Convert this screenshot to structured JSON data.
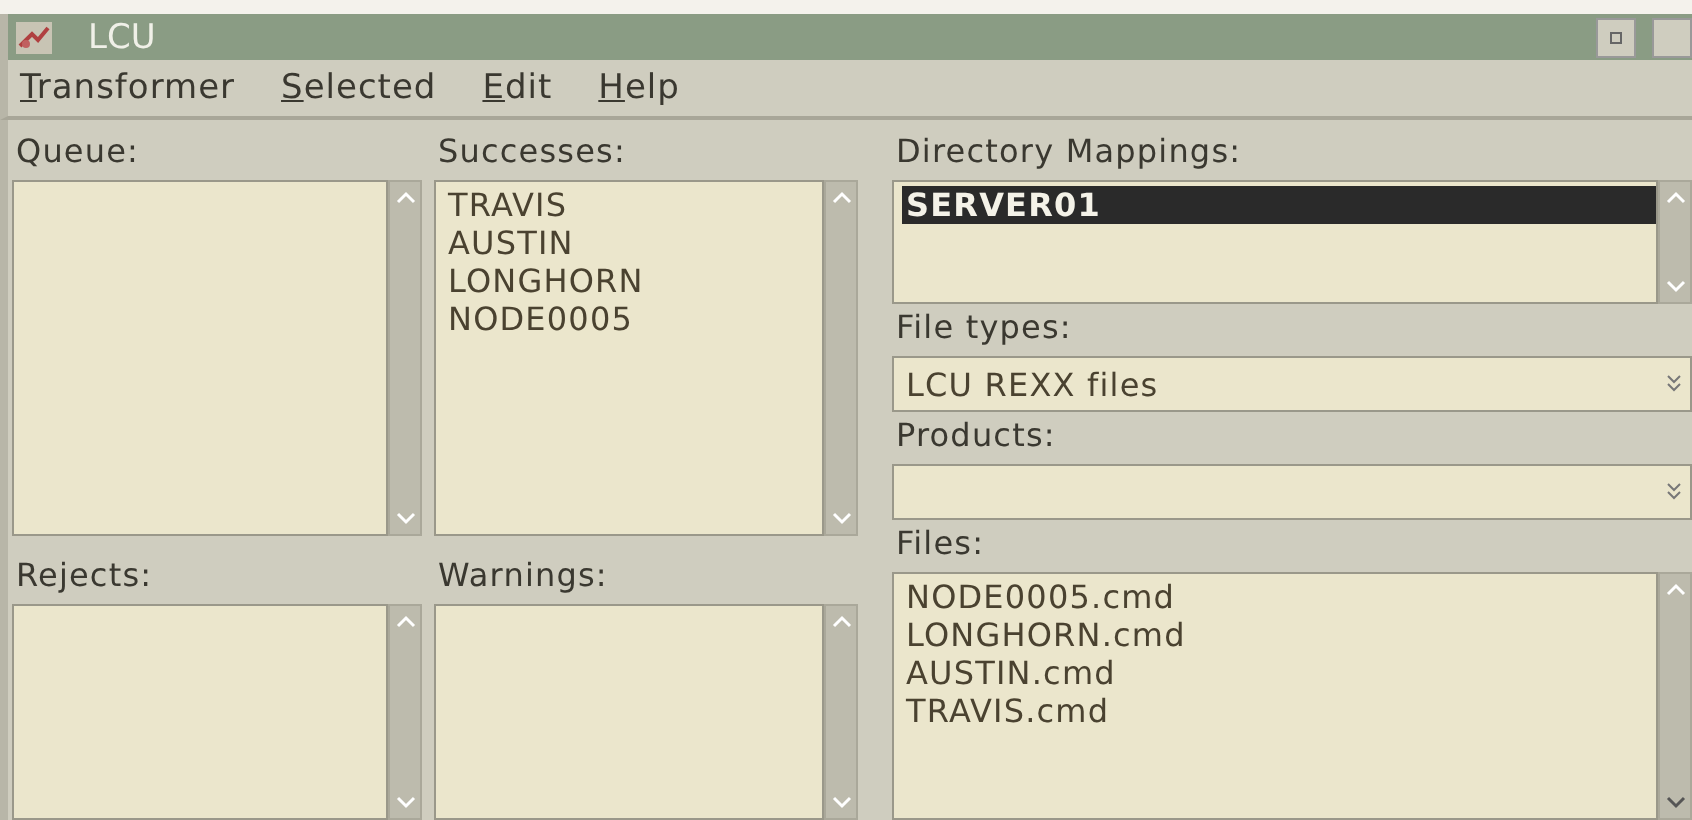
{
  "window": {
    "title": "LCU"
  },
  "menu": [
    {
      "label": "Transformer",
      "mnemonic": true
    },
    {
      "label": "Selected",
      "mnemonic": true
    },
    {
      "label": "Edit",
      "mnemonic": true
    },
    {
      "label": "Help",
      "mnemonic": true
    }
  ],
  "queue": {
    "label": "Queue:"
  },
  "successes": {
    "label": "Successes:",
    "items": [
      {
        "text": "TRAVIS",
        "selected": false
      },
      {
        "text": "AUSTIN",
        "selected": false
      },
      {
        "text": "LONGHORN",
        "selected": false
      },
      {
        "text": "NODE0005",
        "selected": false
      }
    ]
  },
  "rejects": {
    "label": "Rejects:"
  },
  "warnings": {
    "label": "Warnings:"
  },
  "directory_mappings": {
    "label": "Directory Mappings:",
    "items": [
      {
        "text": "SERVER01",
        "selected": true
      }
    ]
  },
  "file_types": {
    "label": "File types:",
    "value": "LCU REXX files"
  },
  "products": {
    "label": "Products:"
  },
  "files": {
    "label": "Files:",
    "items": [
      {
        "text": "NODE0005.cmd",
        "selected": false
      },
      {
        "text": "LONGHORN.cmd",
        "selected": false
      },
      {
        "text": "AUSTIN.cmd",
        "selected": false
      },
      {
        "text": "TRAVIS.cmd",
        "selected": false
      }
    ]
  }
}
